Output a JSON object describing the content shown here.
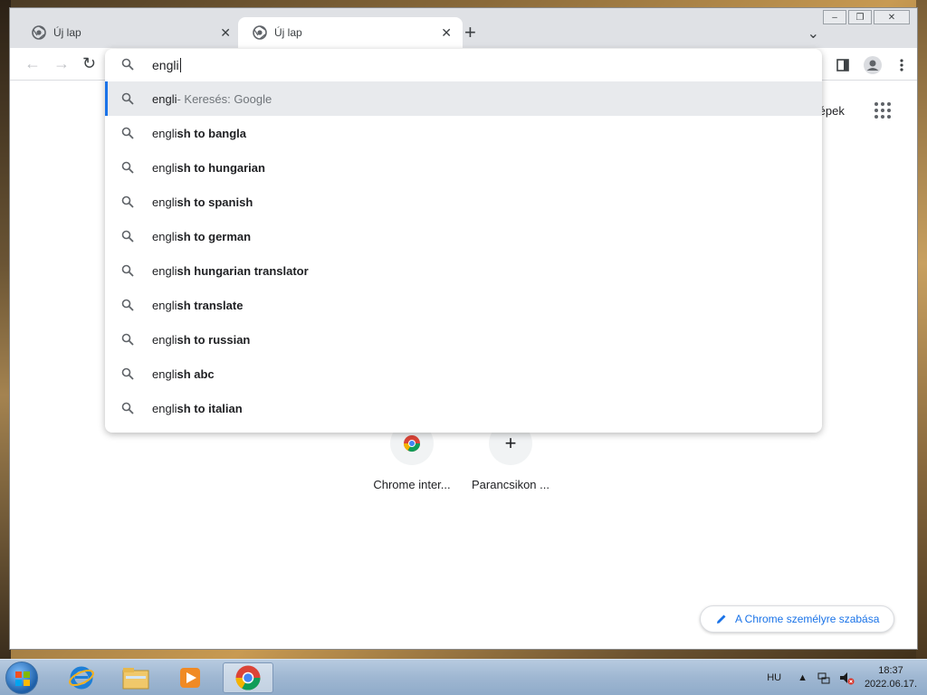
{
  "window": {
    "controls": [
      "–",
      "❐",
      "✕"
    ]
  },
  "tabs": [
    {
      "label": "Új lap",
      "active": false
    },
    {
      "label": "Új lap",
      "active": true
    }
  ],
  "omnibox": {
    "typed": "engli",
    "suggestions": [
      {
        "typed": "engli",
        "rest": "",
        "desc": " - Keresés: Google",
        "selected": true
      },
      {
        "typed": "engli",
        "rest": "sh to bangla",
        "desc": ""
      },
      {
        "typed": "engli",
        "rest": "sh to hungarian",
        "desc": ""
      },
      {
        "typed": "engli",
        "rest": "sh to spanish",
        "desc": ""
      },
      {
        "typed": "engli",
        "rest": "sh to german",
        "desc": ""
      },
      {
        "typed": "engli",
        "rest": "sh hungarian translator",
        "desc": ""
      },
      {
        "typed": "engli",
        "rest": "sh translate",
        "desc": ""
      },
      {
        "typed": "engli",
        "rest": "sh to russian",
        "desc": ""
      },
      {
        "typed": "engli",
        "rest": "sh abc",
        "desc": ""
      },
      {
        "typed": "engli",
        "rest": "sh to italian",
        "desc": ""
      }
    ]
  },
  "page": {
    "images_link": "Képek",
    "shortcuts": [
      {
        "label": "Chrome inter...",
        "icon": "chrome-icon"
      },
      {
        "label": "Parancsikon ...",
        "icon": "plus-icon"
      }
    ],
    "customize_label": "A Chrome személyre szabása"
  },
  "taskbar": {
    "language": "HU",
    "time": "18:37",
    "date": "2022.06.17."
  },
  "colors": {
    "accent": "#1a73e8",
    "tab_bg": "#dfe1e5"
  }
}
